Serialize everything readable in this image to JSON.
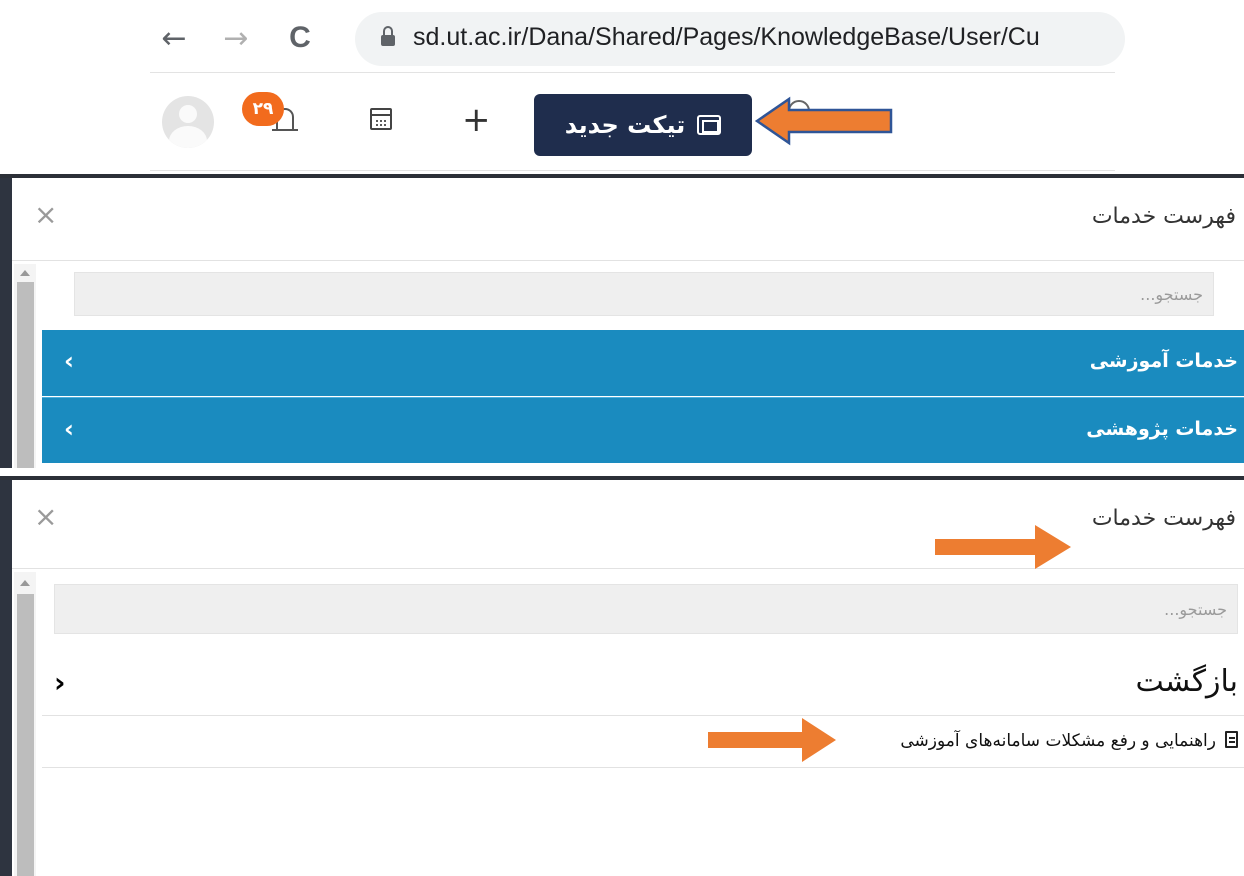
{
  "browser": {
    "url": "sd.ut.ac.ir/Dana/Shared/Pages/KnowledgeBase/User/Cu",
    "nav": {
      "back": "←",
      "forward": "→",
      "reload": "C"
    }
  },
  "toolbar": {
    "notification_count": "۲۹",
    "plus_label": "+",
    "new_ticket_label": "تیکت جدید"
  },
  "dialog1": {
    "title": "فهرست خدمات",
    "close": "×",
    "search_placeholder": "جستجو...",
    "categories": [
      {
        "label": "خدمات آموزشی",
        "chevron": "‹"
      },
      {
        "label": "خدمات پژوهشی",
        "chevron": "‹"
      }
    ]
  },
  "dialog2": {
    "title": "فهرست خدمات",
    "close": "×",
    "search_placeholder": "جستجو...",
    "back_label": "بازگشت",
    "back_chevron": "›",
    "article_label": "راهنمایی و رفع مشکلات سامانه‌های آموزشی"
  },
  "colors": {
    "ticket_button": "#1f2d4d",
    "category_row": "#1a8bbf",
    "badge": "#f26b1d",
    "annotation_arrow": "#ed7d31",
    "annotation_outline": "#2f5597"
  },
  "icons": [
    "back-arrow-icon",
    "forward-arrow-icon",
    "reload-icon",
    "lock-icon",
    "avatar-icon",
    "bell-icon",
    "calendar-icon",
    "plus-icon",
    "ticket-icon",
    "search-icon",
    "close-icon",
    "chevron-left-icon",
    "chevron-right-icon",
    "document-icon"
  ]
}
